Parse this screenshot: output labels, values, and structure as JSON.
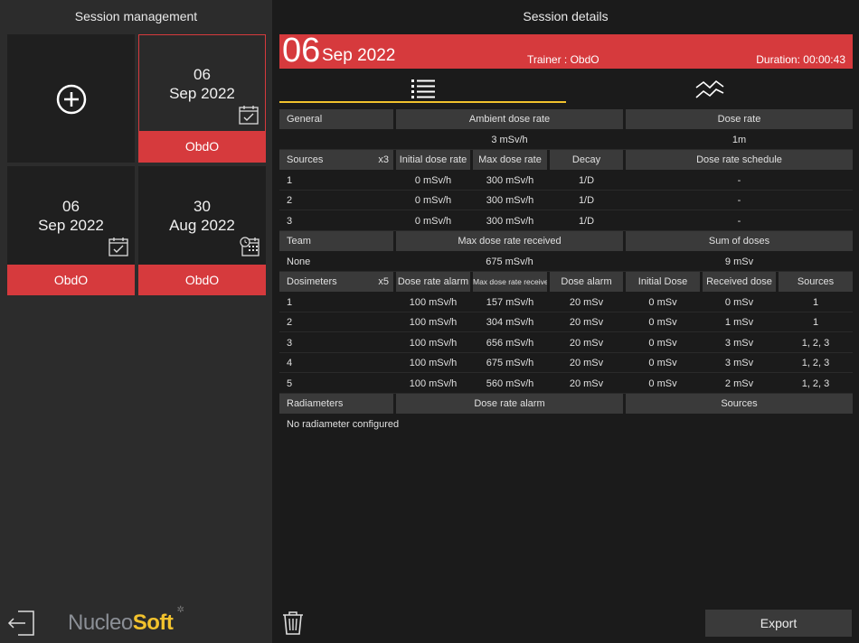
{
  "left": {
    "title": "Session management",
    "sessions": [
      {
        "day": "06",
        "month": "Sep 2022",
        "trainer": "ObdO",
        "icon": "calendar-check-icon"
      },
      {
        "day": "06",
        "month": "Sep 2022",
        "trainer": "ObdO",
        "icon": "calendar-check-icon"
      },
      {
        "day": "30",
        "month": "Aug 2022",
        "trainer": "ObdO",
        "icon": "calendar-clock-icon"
      }
    ],
    "logo": {
      "part1": "Nucleo",
      "part2": "Soft"
    }
  },
  "right": {
    "title": "Session details",
    "banner": {
      "day": "06",
      "month": "Sep 2022",
      "trainer": "Trainer : ObdO",
      "duration": "Duration: 00:00:43"
    },
    "general": {
      "headers": [
        "General",
        "Ambient dose rate",
        "Dose rate"
      ],
      "values": [
        "",
        "3 mSv/h",
        "1m"
      ]
    },
    "sources": {
      "headers": [
        "Sources",
        "Initial dose rate",
        "Max dose rate",
        "Decay",
        "Dose rate schedule"
      ],
      "count": "x3",
      "rows": [
        [
          "1",
          "0 mSv/h",
          "300 mSv/h",
          "1/D",
          "-"
        ],
        [
          "2",
          "0 mSv/h",
          "300 mSv/h",
          "1/D",
          "-"
        ],
        [
          "3",
          "0 mSv/h",
          "300 mSv/h",
          "1/D",
          "-"
        ]
      ]
    },
    "team": {
      "headers": [
        "Team",
        "Max dose rate received",
        "Sum of doses"
      ],
      "values": [
        "None",
        "675 mSv/h",
        "9 mSv"
      ]
    },
    "dosimeters": {
      "headers": [
        "Dosimeters",
        "Dose rate alarm",
        "Max dose rate received",
        "Dose alarm",
        "Initial Dose",
        "Received dose",
        "Sources"
      ],
      "count": "x5",
      "rows": [
        [
          "1",
          "100 mSv/h",
          "157 mSv/h",
          "20 mSv",
          "0 mSv",
          "0 mSv",
          "1"
        ],
        [
          "2",
          "100 mSv/h",
          "304 mSv/h",
          "20 mSv",
          "0 mSv",
          "1 mSv",
          "1"
        ],
        [
          "3",
          "100 mSv/h",
          "656 mSv/h",
          "20 mSv",
          "0 mSv",
          "3 mSv",
          "1, 2, 3"
        ],
        [
          "4",
          "100 mSv/h",
          "675 mSv/h",
          "20 mSv",
          "0 mSv",
          "3 mSv",
          "1, 2, 3"
        ],
        [
          "5",
          "100 mSv/h",
          "560 mSv/h",
          "20 mSv",
          "0 mSv",
          "2 mSv",
          "1, 2, 3"
        ]
      ]
    },
    "radiameters": {
      "headers": [
        "Radiameters",
        "Dose rate alarm",
        "Sources"
      ],
      "empty": "No radiameter configured"
    },
    "export_label": "Export"
  },
  "colors": {
    "accent": "#d63a3d",
    "tab_underline": "#f2c22d"
  }
}
